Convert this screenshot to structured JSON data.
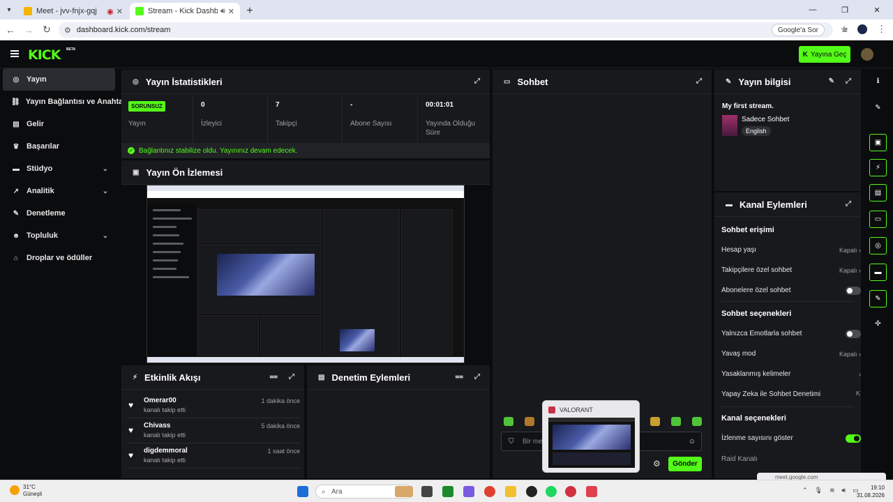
{
  "browser": {
    "tabs": [
      {
        "label": "Meet - jvv-fnjx-gqj",
        "active": false
      },
      {
        "label": "Stream - Kick Dashboard",
        "active": true
      }
    ],
    "url": "dashboard.kick.com/stream",
    "google_sor": "Google'a Sor"
  },
  "header": {
    "logo": "KICK",
    "beta": "BETA",
    "go_live": "Yayına Geç"
  },
  "sidebar": {
    "items": [
      {
        "label": "Yayın",
        "icon": "target-icon",
        "active": true
      },
      {
        "label": "Yayın Bağlantısı ve Anahtarı",
        "icon": "link-icon"
      },
      {
        "label": "Gelir",
        "icon": "wallet-icon"
      },
      {
        "label": "Başarılar",
        "icon": "trophy-icon"
      },
      {
        "label": "Stüdyo",
        "icon": "studio-icon",
        "expandable": true
      },
      {
        "label": "Analitik",
        "icon": "chart-icon",
        "expandable": true
      },
      {
        "label": "Denetleme",
        "icon": "wrench-icon"
      },
      {
        "label": "Topluluk",
        "icon": "people-icon",
        "expandable": true
      },
      {
        "label": "Droplar ve ödüller",
        "icon": "gift-icon"
      }
    ]
  },
  "stats": {
    "title": "Yayın İstatistikleri",
    "status_badge": "SORUNSUZ",
    "cells": [
      {
        "value": "",
        "label": "Yayın"
      },
      {
        "value": "0",
        "label": "İzleyici"
      },
      {
        "value": "7",
        "label": "Takipçi"
      },
      {
        "value": "-",
        "label": "Abone Sayısı"
      },
      {
        "value": "00:01:01",
        "label": "Yayında Olduğu Süre"
      }
    ],
    "stable_msg": "Bağlantınız stabilize oldu. Yayınınız devam edecek."
  },
  "preview": {
    "title": "Yayın Ön İzlemesi"
  },
  "event_feed": {
    "title": "Etkinlik Akışı",
    "events": [
      {
        "name": "Omerar00",
        "action": "kanalı takip etti",
        "time": "1 dakika önce"
      },
      {
        "name": "Chivass",
        "action": "kanalı takip etti",
        "time": "5 dakika önce"
      },
      {
        "name": "digdemmoral",
        "action": "kanalı takip etti",
        "time": "1 saat önce"
      }
    ]
  },
  "mod_actions": {
    "title": "Denetim Eylemleri"
  },
  "chat": {
    "title": "Sohbet",
    "placeholder": "Bir mesaj gönder",
    "send": "Gönder"
  },
  "stream_info": {
    "title": "Yayın bilgisi",
    "stream_title": "My first stream.",
    "category": "Sadece Sohbet",
    "language": "English"
  },
  "channel_actions": {
    "title": "Kanal Eylemleri",
    "chat_access_heading": "Sohbet erişimi",
    "chat_access": [
      {
        "label": "Hesap yaşı",
        "value": "Kapalı",
        "type": "select"
      },
      {
        "label": "Takipçilere özel sohbet",
        "value": "Kapalı",
        "type": "select"
      },
      {
        "label": "Abonelere özel sohbet",
        "value": "",
        "type": "toggle",
        "on": false
      }
    ],
    "chat_options_heading": "Sohbet seçenekleri",
    "chat_options": [
      {
        "label": "Yalnızca Emotlarla sohbet",
        "value": "",
        "type": "toggle",
        "on": false
      },
      {
        "label": "Yavaş mod",
        "value": "Kapalı",
        "type": "select"
      },
      {
        "label": "Yasaklanmış kelimeler",
        "value": "",
        "type": "link"
      },
      {
        "label": "Yapay Zeka ile Sohbet Denetimi",
        "value": "",
        "type": "external"
      }
    ],
    "channel_options_heading": "Kanal seçenekleri",
    "channel_options": [
      {
        "label": "İzlenme sayısını göster",
        "value": "",
        "type": "toggle",
        "on": true
      },
      {
        "label": "Raid Kanalı",
        "value": "",
        "type": "link"
      }
    ]
  },
  "hover_preview": {
    "title": "VALORANT"
  },
  "taskbar": {
    "temp": "31°C",
    "weather": "Güneşli",
    "search": "Ara",
    "time": "19:10",
    "date": "31.08.2026",
    "meet_popup": "meet.google.com"
  },
  "colors": {
    "accent": "#53fc18",
    "panel": "#18191c",
    "bg": "#0b0c0e"
  }
}
